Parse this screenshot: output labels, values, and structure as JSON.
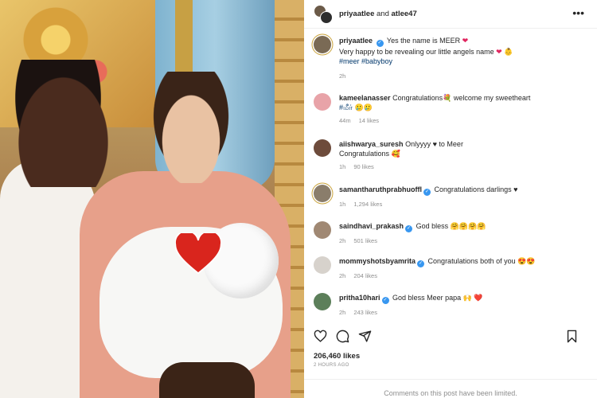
{
  "post_header": {
    "author": "priyaatlee",
    "connector": " and ",
    "collaborator": "atlee47",
    "more_icon": "ellipsis-icon"
  },
  "caption": {
    "user": "priyaatlee",
    "line1": "Yes the name is MEER",
    "line2": "Very happy to be revealing our little angels name",
    "hashtags": "#meer #babyboy",
    "time": "2h"
  },
  "comments": [
    {
      "user": "kameelanasser",
      "verified": false,
      "text": "Congratulations💐 welcome my sweetheart",
      "text2": "#மீர் 🥲🥲",
      "time": "44m",
      "likes": "14 likes",
      "avatar_color": "#e8a3a8"
    },
    {
      "user": "aiishwarya_suresh",
      "verified": false,
      "text": "Onlyyyy ♥ to Meer",
      "text2": "Congratulations 🥰",
      "time": "1h",
      "likes": "90 likes",
      "avatar_color": "#6d4b3b"
    },
    {
      "user": "samantharuthprabhuoffl",
      "verified": true,
      "text": "Congratulations darlings ♥",
      "text2": "",
      "time": "1h",
      "likes": "1,294 likes",
      "avatar_color": "#8a7d6b"
    },
    {
      "user": "saindhavi_prakash",
      "verified": true,
      "text": "God bless 🤗🤗🤗🤗",
      "text2": "",
      "time": "2h",
      "likes": "501 likes",
      "avatar_color": "#a08873"
    },
    {
      "user": "mommyshotsbyamrita",
      "verified": true,
      "text": "Congratulations both of you 😍😍",
      "text2": "",
      "time": "2h",
      "likes": "204 likes",
      "avatar_color": "#d7d2cc"
    },
    {
      "user": "pritha10hari",
      "verified": true,
      "text": "God bless Meer papa 🙌 ❤️",
      "text2": "",
      "time": "2h",
      "likes": "243 likes",
      "avatar_color": "#5c7f5a"
    }
  ],
  "actions": {
    "icons": [
      "heart-icon",
      "comment-icon",
      "share-icon",
      "bookmark-icon"
    ]
  },
  "likes": "206,460 likes",
  "posted_ago": "2 HOURS AGO",
  "footer": "Comments on this post have been limited."
}
